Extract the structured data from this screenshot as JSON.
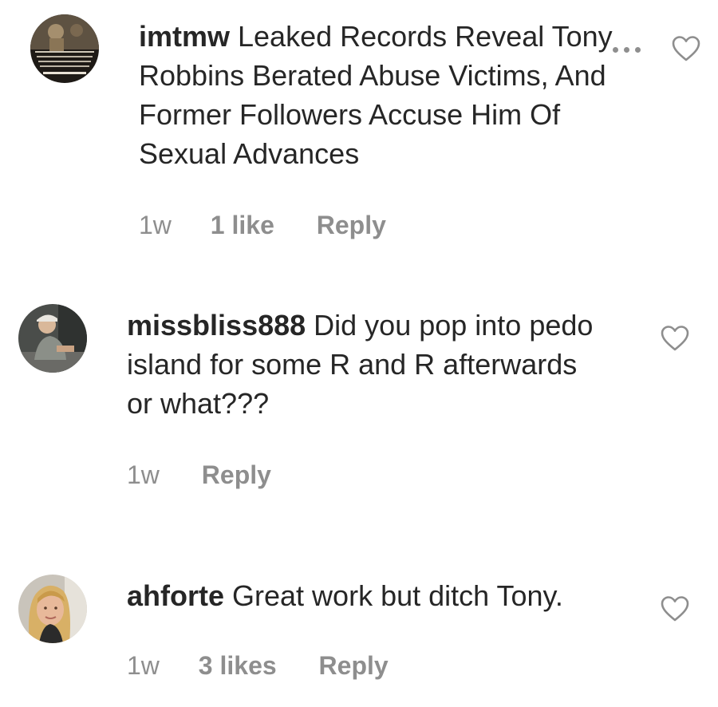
{
  "comments": [
    {
      "username": "imtmw",
      "text": " Leaked Records Reveal Tony Robbins Berated Abuse Victims, And Former Followers Accuse Him Of Sexual Advances",
      "time": "1w",
      "likes": "1 like",
      "reply": "Reply",
      "avatar_icon": "quote-image-avatar",
      "has_more": true
    },
    {
      "username": "missbliss888",
      "text": " Did you pop into pedo island for some R and R afterwards or what???",
      "time": "1w",
      "likes": "",
      "reply": "Reply",
      "avatar_icon": "person-photo-avatar",
      "has_more": false
    },
    {
      "username": "ahforte",
      "text": " Great work but ditch Tony.",
      "time": "1w",
      "likes": "3 likes",
      "reply": "Reply",
      "avatar_icon": "person-photo-avatar",
      "has_more": false
    }
  ],
  "colors": {
    "text": "#262626",
    "meta": "#8e8e8e",
    "heart_stroke": "#8e8e8e"
  },
  "icons": {
    "like": "heart-outline-icon",
    "more": "more-dots-icon"
  }
}
